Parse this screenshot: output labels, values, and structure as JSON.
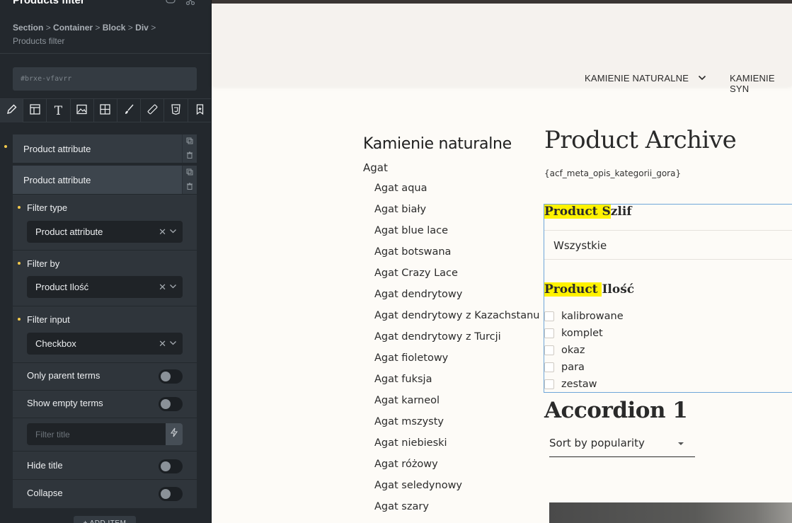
{
  "panel": {
    "title": "Products filter",
    "breadcrumb": [
      "Section",
      "Container",
      "Block",
      "Div"
    ],
    "breadcrumb_sep": ">",
    "breadcrumb_current": "Products filter",
    "element_id": "#brxe-vfavrr",
    "tabs": [
      "pencil-icon",
      "layout-icon",
      "text-icon",
      "image-icon",
      "grid-icon",
      "brush-icon",
      "ruler-icon",
      "css-icon",
      "bookmark-icon"
    ],
    "tab_text_glyph": "T",
    "repeater_items": [
      {
        "label": "Product attribute"
      },
      {
        "label": "Product attribute"
      }
    ],
    "settings": {
      "filter_type": {
        "label": "Filter type",
        "value": "Product attribute"
      },
      "filter_by": {
        "label": "Filter by",
        "value": "Product Ilość"
      },
      "filter_input": {
        "label": "Filter input",
        "value": "Checkbox"
      },
      "only_parent_terms": {
        "label": "Only parent terms"
      },
      "show_empty_terms": {
        "label": "Show empty terms"
      },
      "filter_title": {
        "placeholder": "Filter title"
      },
      "hide_title": {
        "label": "Hide title"
      },
      "collapse": {
        "label": "Collapse"
      }
    },
    "clear_glyph": "✕",
    "chevron_glyph": "⌄",
    "add_item": "+ ADD ITEM",
    "accent": "#f2c94c"
  },
  "site": {
    "nav": [
      "KAMIENIE NATURALNE",
      "KAMIENIE SYN"
    ],
    "categories_title": "Kamienie naturalne",
    "category_parent": "Agat",
    "categories": [
      "Agat aqua",
      "Agat biały",
      "Agat blue lace",
      "Agat botswana",
      "Agat Crazy Lace",
      "Agat dendrytowy",
      "Agat dendrytowy z Kazachstanu",
      "Agat dendrytowy z Turcji",
      "Agat fioletowy",
      "Agat fuksja",
      "Agat karneol",
      "Agat mszysty",
      "Agat niebieski",
      "Agat różowy",
      "Agat seledynowy",
      "Agat szary"
    ],
    "archive_title": "Product Archive",
    "acf_meta": "{acf_meta_opis_kategorii_gora}",
    "filters": {
      "szlif": {
        "prefix": "Product S",
        "suffix": "zlif",
        "select_value": "Wszystkie"
      },
      "ilosc": {
        "prefix": "Product ",
        "suffix": "Ilość",
        "options": [
          "kalibrowane",
          "komplet",
          "okaz",
          "para",
          "zestaw"
        ]
      }
    },
    "accordion_title": "Accordion 1",
    "sort_label": "Sort by popularity"
  }
}
